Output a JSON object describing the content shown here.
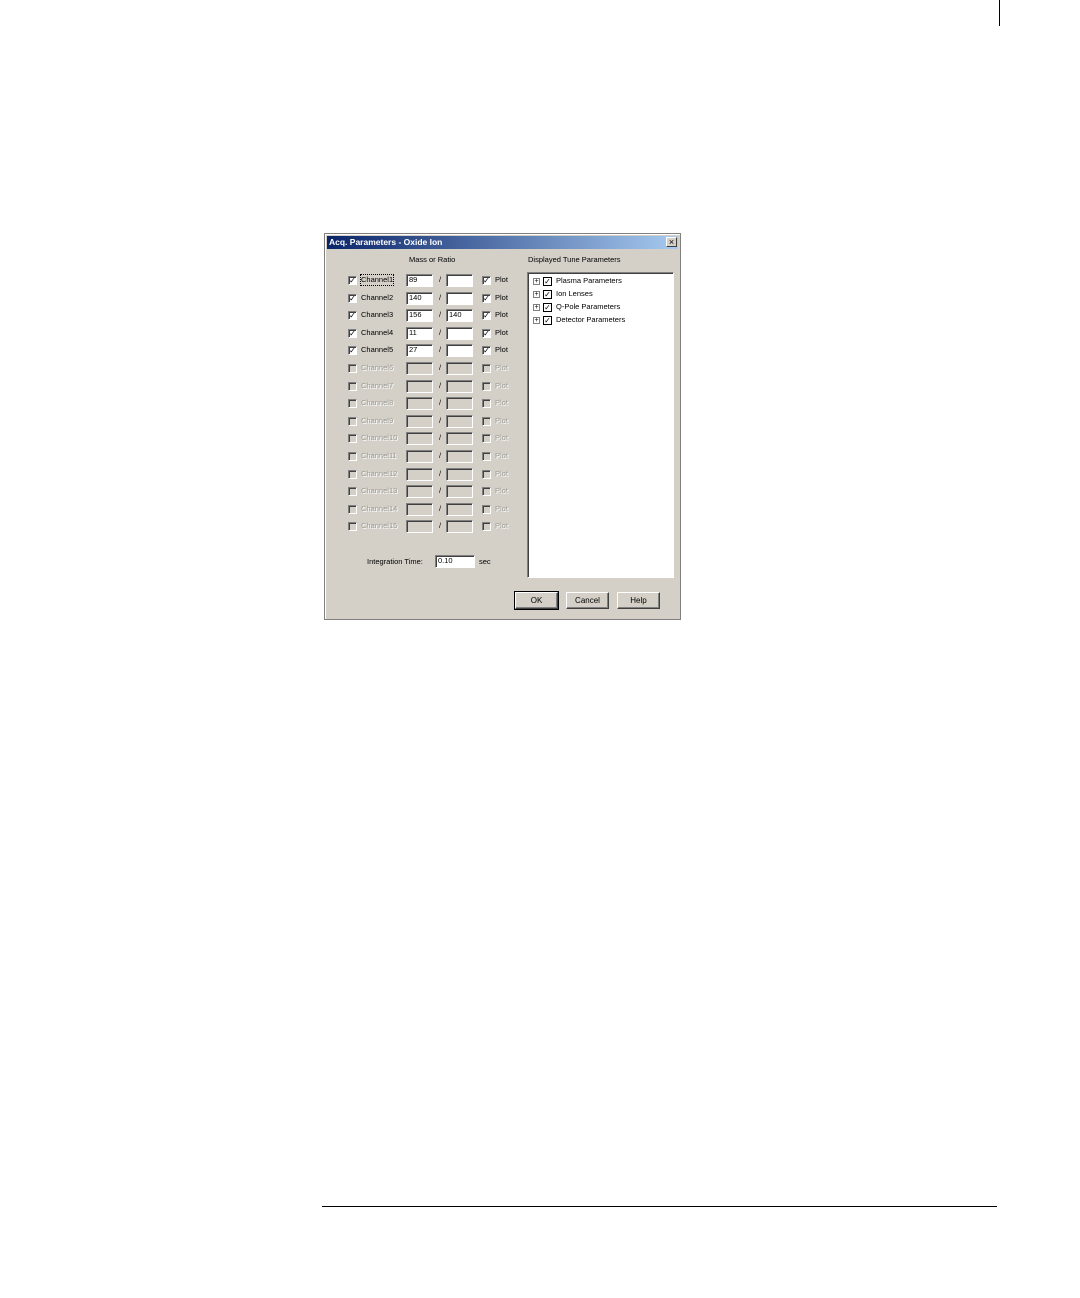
{
  "dialog": {
    "title": "Acq. Parameters - Oxide Ion",
    "close_glyph": "×",
    "mass_header": "Mass or Ratio",
    "tune_header": "Displayed Tune Parameters",
    "integration_label": "Integration Time:",
    "integration_value": "0.10",
    "integration_unit": "sec",
    "check_mark": "✓",
    "slash": "/",
    "plot_label": "Plot",
    "channels": [
      {
        "label": "Channel1",
        "checked": true,
        "mass1": "89",
        "mass2": "",
        "plot": true,
        "enabled": true
      },
      {
        "label": "Channel2",
        "checked": true,
        "mass1": "140",
        "mass2": "",
        "plot": true,
        "enabled": true
      },
      {
        "label": "Channel3",
        "checked": true,
        "mass1": "156",
        "mass2": "140",
        "plot": true,
        "enabled": true
      },
      {
        "label": "Channel4",
        "checked": true,
        "mass1": "11",
        "mass2": "",
        "plot": true,
        "enabled": true
      },
      {
        "label": "Channel5",
        "checked": true,
        "mass1": "27",
        "mass2": "",
        "plot": true,
        "enabled": true
      },
      {
        "label": "Channel6",
        "checked": false,
        "mass1": "",
        "mass2": "",
        "plot": false,
        "enabled": false
      },
      {
        "label": "Channel7",
        "checked": false,
        "mass1": "",
        "mass2": "",
        "plot": false,
        "enabled": false
      },
      {
        "label": "Channel8",
        "checked": false,
        "mass1": "",
        "mass2": "",
        "plot": false,
        "enabled": false
      },
      {
        "label": "Channel9",
        "checked": false,
        "mass1": "",
        "mass2": "",
        "plot": false,
        "enabled": false
      },
      {
        "label": "Channel10",
        "checked": false,
        "mass1": "",
        "mass2": "",
        "plot": false,
        "enabled": false
      },
      {
        "label": "Channel11",
        "checked": false,
        "mass1": "",
        "mass2": "",
        "plot": false,
        "enabled": false
      },
      {
        "label": "Channel12",
        "checked": false,
        "mass1": "",
        "mass2": "",
        "plot": false,
        "enabled": false
      },
      {
        "label": "Channel13",
        "checked": false,
        "mass1": "",
        "mass2": "",
        "plot": false,
        "enabled": false
      },
      {
        "label": "Channel14",
        "checked": false,
        "mass1": "",
        "mass2": "",
        "plot": false,
        "enabled": false
      },
      {
        "label": "Channel15",
        "checked": false,
        "mass1": "",
        "mass2": "",
        "plot": false,
        "enabled": false
      }
    ],
    "tune_items": [
      {
        "label": "Plasma Parameters",
        "checked": true
      },
      {
        "label": "Ion Lenses",
        "checked": true
      },
      {
        "label": "Q-Pole Parameters",
        "checked": true
      },
      {
        "label": "Detector Parameters",
        "checked": true
      }
    ],
    "expand_glyph": "+",
    "buttons": {
      "ok": "OK",
      "cancel": "Cancel",
      "help": "Help"
    }
  }
}
